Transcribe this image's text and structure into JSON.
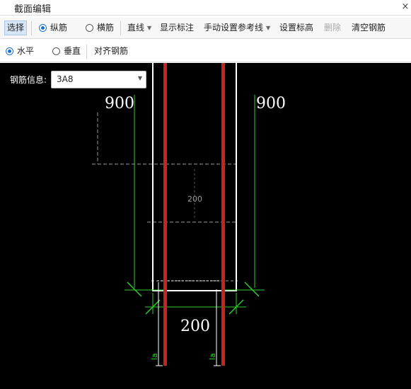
{
  "window": {
    "title": "截面编辑",
    "close_glyph": "×"
  },
  "toolbar": {
    "select_label": "选择",
    "longitudinal_label": "纵筋",
    "transverse_label": "横筋",
    "line_label": "直线",
    "show_dim_label": "显示标注",
    "manual_ref_label": "手动设置参考线",
    "set_elev_label": "设置标高",
    "delete_label": "删除",
    "clear_rebar_label": "清空钢筋",
    "longitudinal_checked": true,
    "transverse_checked": false
  },
  "toolbar2": {
    "horizontal_label": "水平",
    "vertical_label": "垂直",
    "align_label": "对齐钢筋",
    "horizontal_checked": true,
    "vertical_checked": false
  },
  "rebar_info": {
    "label": "钢筋信息:",
    "value": "3A8"
  },
  "drawing": {
    "dim_left": "900",
    "dim_right": "900",
    "dim_center_small": "200",
    "dim_bottom": "200",
    "anchor_left": "la",
    "anchor_right": "la"
  },
  "colors": {
    "accent": "#1e6fd0",
    "rebar": "#c62424",
    "dimension": "#2fcc2f",
    "outline": "#ffffff"
  }
}
